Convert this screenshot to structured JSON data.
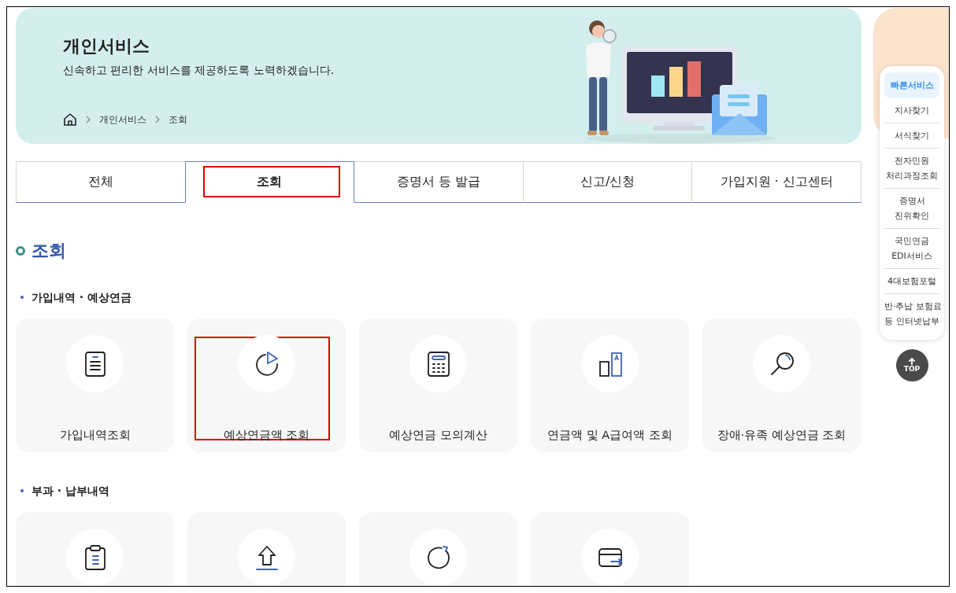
{
  "banner": {
    "title": "개인서비스",
    "subtitle": "신속하고 편리한 서비스를 제공하도록 노력하겠습니다.",
    "breadcrumb": [
      "개인서비스",
      "조회"
    ]
  },
  "tabs": [
    {
      "label": "전체",
      "selected": false,
      "highlighted": false
    },
    {
      "label": "조회",
      "selected": true,
      "highlighted": true
    },
    {
      "label": "증명서 등 발급",
      "selected": false,
      "highlighted": false
    },
    {
      "label": "신고/신청",
      "selected": false,
      "highlighted": false
    },
    {
      "label": "가입지원 · 신고센터",
      "selected": false,
      "highlighted": false
    }
  ],
  "section_title": "조회",
  "groups": [
    {
      "title": "가입내역 · 예상연금",
      "cards": [
        {
          "label": "가입내역조회",
          "kind": "document",
          "highlighted": false
        },
        {
          "label": "예상연금액 조회",
          "kind": "pie",
          "highlighted": true
        },
        {
          "label": "예상연금 모의계산",
          "kind": "calculator",
          "highlighted": false
        },
        {
          "label": "연금액 및 A급여액 조회",
          "kind": "compare",
          "highlighted": false
        },
        {
          "label": "장애·유족 예상연금 조회",
          "kind": "magnifier",
          "highlighted": false
        }
      ]
    },
    {
      "title": "부과 · 납부내역",
      "cards": [
        {
          "kind": "clipboard"
        },
        {
          "kind": "upload"
        },
        {
          "kind": "refresh"
        },
        {
          "kind": "wallet"
        }
      ]
    }
  ],
  "quick_menu": {
    "title": "빠른서비스",
    "items": [
      {
        "lines": [
          "지사찾기"
        ]
      },
      {
        "lines": [
          "서식찾기"
        ]
      },
      {
        "lines": [
          "전자민원",
          "처리과정조회"
        ]
      },
      {
        "lines": [
          "증명서",
          "진위확인"
        ]
      },
      {
        "lines": [
          "국민연금",
          "EDI서비스"
        ]
      },
      {
        "lines": [
          "4대보험포털"
        ]
      },
      {
        "lines": [
          "반·추납 보험료",
          "등 인터넷납부"
        ]
      }
    ]
  },
  "top_button": "TOP"
}
